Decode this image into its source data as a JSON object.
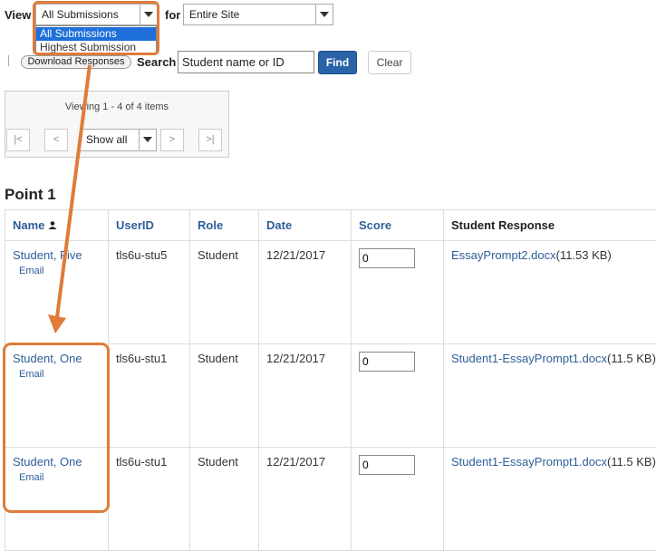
{
  "filter": {
    "view_label": "View",
    "view_selected": "All Submissions",
    "view_options": [
      "All Submissions",
      "Highest Submission"
    ],
    "for_label": "for",
    "for_selected": "Entire Site"
  },
  "toolbar": {
    "download_label": "Download Responses",
    "search_label": "Search",
    "search_value": "Student name or ID",
    "find_label": "Find",
    "clear_label": "Clear"
  },
  "pager": {
    "status": "Viewing 1 - 4 of 4 items",
    "first": "|<",
    "prev": "<",
    "show": "Show all",
    "next": ">",
    "last": ">|"
  },
  "section_title": "Point 1",
  "table": {
    "headers": [
      "Name",
      "UserID",
      "Role",
      "Date",
      "Score",
      "Student Response"
    ],
    "rows": [
      {
        "name": "Student, Five",
        "email": "Email",
        "userid": "tls6u-stu5",
        "role": "Student",
        "date": "12/21/2017",
        "score": "0",
        "file": "EssayPrompt2.docx",
        "size": "(11.53 KB)"
      },
      {
        "name": "Student, One",
        "email": "Email",
        "userid": "tls6u-stu1",
        "role": "Student",
        "date": "12/21/2017",
        "score": "0",
        "file": "Student1-EssayPrompt1.docx",
        "size": "(11.5 KB)"
      },
      {
        "name": "Student, One",
        "email": "Email",
        "userid": "tls6u-stu1",
        "role": "Student",
        "date": "12/21/2017",
        "score": "0",
        "file": "Student1-EssayPrompt1.docx",
        "size": "(11.5 KB)"
      }
    ]
  },
  "colors": {
    "highlight": "#e07b39",
    "link": "#2e5e99",
    "primary_button": "#2a63a8",
    "dropdown_selected": "#1e6fd9"
  }
}
